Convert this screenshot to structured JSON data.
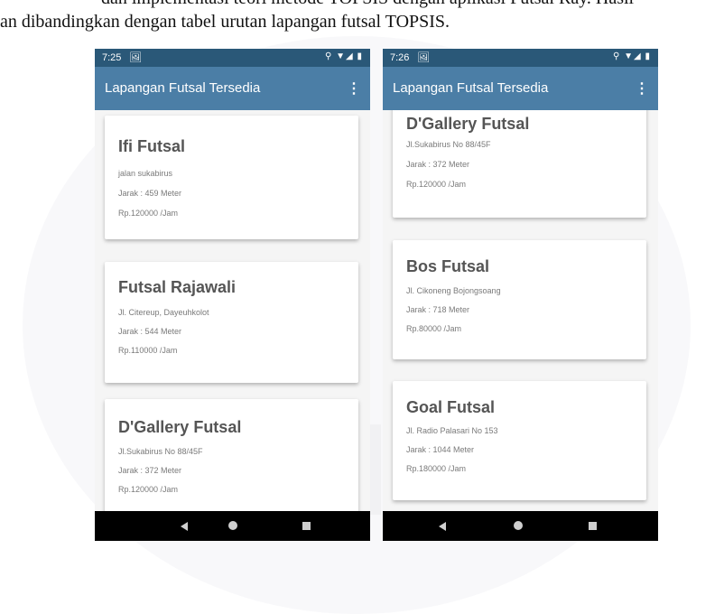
{
  "caption": {
    "line1": "dan implementasi teori metode TOPSIS dengan aplikasi Futsal Ray. Hasil",
    "line2": "an dibandingkan dengan tabel urutan lapangan futsal TOPSIS."
  },
  "phones": [
    {
      "time": "7:25",
      "title": "Lapangan Futsal Tersedia",
      "cards": [
        {
          "name": "Ifi Futsal",
          "address": "jalan sukabirus",
          "distance": "Jarak : 459 Meter",
          "price": "Rp.120000 /Jam"
        },
        {
          "name": "Futsal Rajawali",
          "address": "Jl. Citereup, Dayeuhkolot",
          "distance": "Jarak : 544 Meter",
          "price": "Rp.110000 /Jam"
        },
        {
          "name": "D'Gallery Futsal",
          "address": "Jl.Sukabirus No 88/45F",
          "distance": "Jarak : 372 Meter",
          "price": "Rp.120000 /Jam"
        }
      ]
    },
    {
      "time": "7:26",
      "title": "Lapangan Futsal Tersedia",
      "cards": [
        {
          "name": "D'Gallery Futsal",
          "address": "Jl.Sukabirus No 88/45F",
          "distance": "Jarak : 372 Meter",
          "price": "Rp.120000 /Jam"
        },
        {
          "name": "Bos Futsal",
          "address": "Jl. Cikoneng Bojongsoang",
          "distance": "Jarak : 718 Meter",
          "price": "Rp.80000 /Jam"
        },
        {
          "name": "Goal Futsal",
          "address": "Jl. Radio Palasari No 153",
          "distance": "Jarak : 1044 Meter",
          "price": "Rp.180000 /Jam"
        }
      ]
    }
  ],
  "icons": {
    "notification": "image-notification-icon",
    "status": "location-wifi-signal-battery-icons",
    "menu": "overflow-menu-icon",
    "nav": [
      "back-icon",
      "home-icon",
      "recents-icon"
    ]
  },
  "colors": {
    "status_bar": "#2a5878",
    "app_bar": "#4b7ea6",
    "nav_bar": "#000000"
  }
}
